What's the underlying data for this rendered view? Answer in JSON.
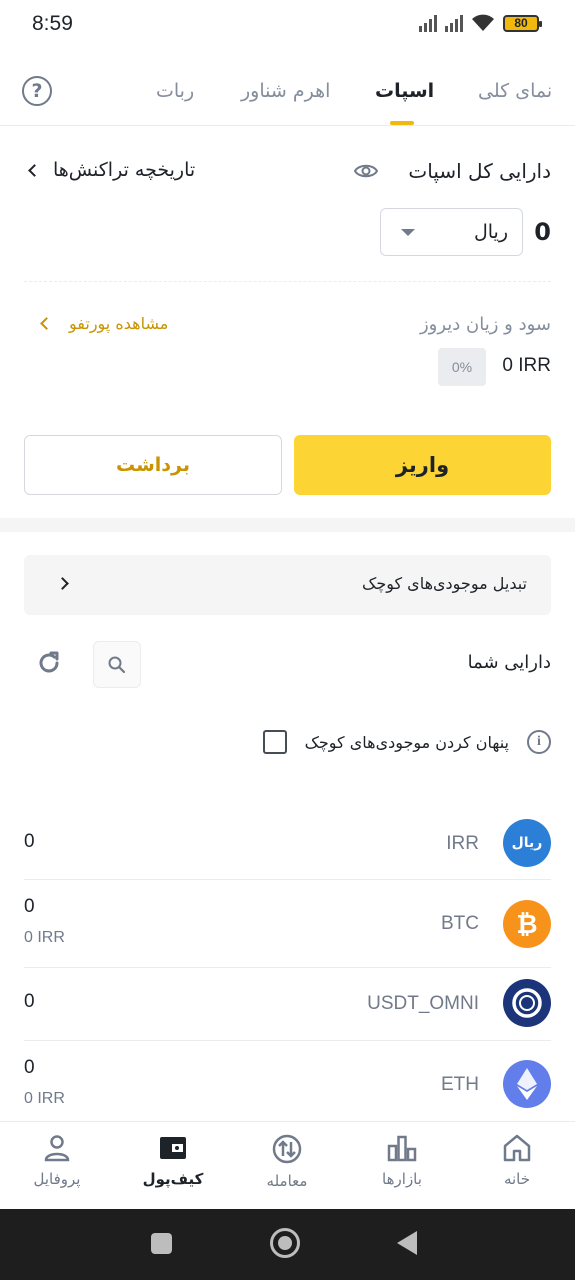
{
  "status_bar": {
    "time": "8:59",
    "battery": "80"
  },
  "header": {
    "tabs": [
      {
        "label": "نمای کلی",
        "active": false
      },
      {
        "label": "اسپات",
        "active": true
      },
      {
        "label": "اهرم شناور",
        "active": false
      },
      {
        "label": "ربات",
        "active": false
      }
    ]
  },
  "spot": {
    "total_label": "دارایی کل اسپات",
    "history_label": "تاریخچه تراکنش‌ها",
    "balance": "0",
    "currency": "ریال",
    "pnl_label": "سود و زیان دیروز",
    "portfolio_label": "مشاهده پورتفو",
    "pnl_value": "0 IRR",
    "pnl_percent": "0%",
    "deposit_label": "واریز",
    "withdraw_label": "برداشت"
  },
  "small_balances": {
    "convert_label": "تبدیل موجودی‌های کوچک"
  },
  "assets": {
    "title": "دارایی شما",
    "hide_small_label": "پنهان کردن موجودی‌های کوچک",
    "hide_small_checked": false,
    "items": [
      {
        "symbol": "IRR",
        "amount": "0",
        "fiat": "",
        "icon": "rial-icon",
        "color": "#2b7fd6",
        "badge": "ریال"
      },
      {
        "symbol": "BTC",
        "amount": "0",
        "fiat": "0 IRR",
        "icon": "bitcoin-icon",
        "color": "#f7931a",
        "badge": "₿"
      },
      {
        "symbol": "USDT_OMNI",
        "amount": "0",
        "fiat": "",
        "icon": "omni-icon",
        "color": "#1c347a",
        "badge": ""
      },
      {
        "symbol": "ETH",
        "amount": "0",
        "fiat": "0 IRR",
        "icon": "ethereum-icon",
        "color": "#627eea",
        "badge": ""
      }
    ]
  },
  "bottom_nav": {
    "items": [
      {
        "label": "پروفایل",
        "icon": "profile-icon",
        "active": false
      },
      {
        "label": "کیف‌پول",
        "icon": "wallet-icon",
        "active": true
      },
      {
        "label": "معامله",
        "icon": "trade-icon",
        "active": false
      },
      {
        "label": "بازارها",
        "icon": "markets-icon",
        "active": false
      },
      {
        "label": "خانه",
        "icon": "home-icon",
        "active": false
      }
    ]
  },
  "colors": {
    "accent": "#fcd535",
    "link": "#c99400",
    "text": "#1e2329",
    "muted": "#848e9c"
  }
}
